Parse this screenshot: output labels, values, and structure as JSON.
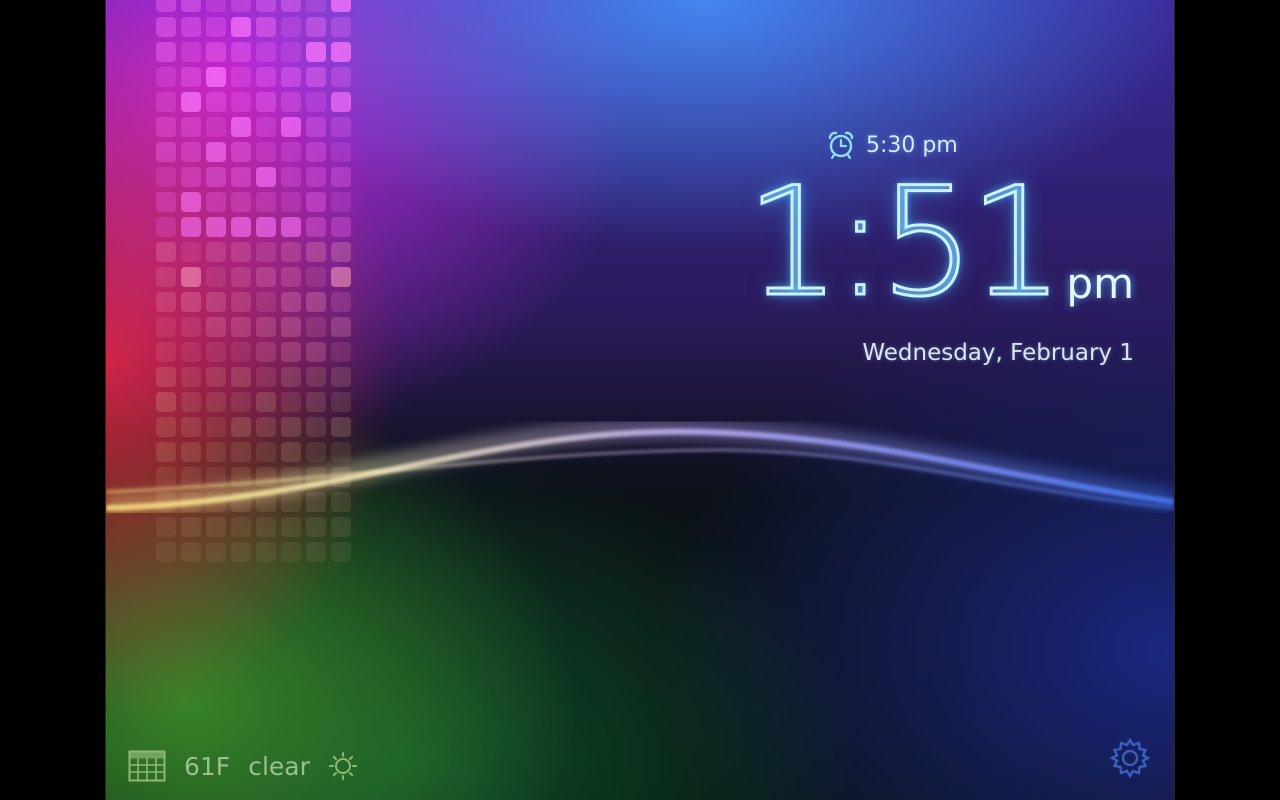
{
  "alarm": {
    "time": "5:30 pm",
    "icon": "alarm-clock-icon"
  },
  "clock": {
    "time": "1:51",
    "ampm": "pm"
  },
  "date": "Wednesday, February 1",
  "weather": {
    "temperature": "61F",
    "condition": "clear",
    "icon": "sun-icon"
  },
  "icons": {
    "calendar": "calendar-icon",
    "settings": "gear-icon"
  },
  "colors": {
    "glow": "#7ad4ff",
    "weather_text": "#9bbf8f"
  }
}
